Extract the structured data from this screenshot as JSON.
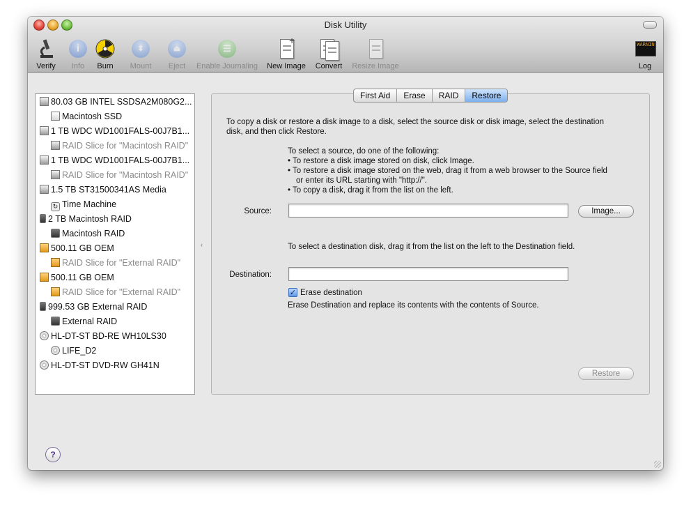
{
  "window": {
    "title": "Disk Utility"
  },
  "toolbar": {
    "items": [
      {
        "label": "Verify",
        "icon": "microscope-icon",
        "enabled": true
      },
      {
        "label": "Info",
        "icon": "info-icon",
        "enabled": false
      },
      {
        "label": "Burn",
        "icon": "burn-icon",
        "enabled": true
      },
      {
        "label": "Mount",
        "icon": "mount-icon",
        "enabled": false
      },
      {
        "label": "Eject",
        "icon": "eject-icon",
        "enabled": false
      },
      {
        "label": "Enable Journaling",
        "icon": "journal-icon",
        "enabled": false
      },
      {
        "label": "New Image",
        "icon": "new-image-icon",
        "enabled": true
      },
      {
        "label": "Convert",
        "icon": "convert-icon",
        "enabled": true
      },
      {
        "label": "Resize Image",
        "icon": "resize-image-icon",
        "enabled": false
      }
    ],
    "log_label": "Log",
    "log_icon_text": "WARNIN"
  },
  "sidebar": {
    "items": [
      {
        "label": "80.03 GB INTEL SSDSA2M080G2...",
        "kind": "disk",
        "dim": false
      },
      {
        "label": "Macintosh SSD",
        "kind": "volume",
        "dim": false
      },
      {
        "label": "1 TB WDC WD1001FALS-00J7B1...",
        "kind": "disk",
        "dim": false
      },
      {
        "label": "RAID Slice for \"Macintosh RAID\"",
        "kind": "volume",
        "dim": true
      },
      {
        "label": "1 TB WDC WD1001FALS-00J7B1...",
        "kind": "disk",
        "dim": false
      },
      {
        "label": "RAID Slice for \"Macintosh RAID\"",
        "kind": "volume",
        "dim": true
      },
      {
        "label": "1.5 TB ST31500341AS Media",
        "kind": "disk",
        "dim": false
      },
      {
        "label": "Time Machine",
        "kind": "timemachine",
        "dim": false
      },
      {
        "label": "2 TB Macintosh RAID",
        "kind": "raid",
        "dim": false
      },
      {
        "label": "Macintosh RAID",
        "kind": "raid-volume",
        "dim": false
      },
      {
        "label": "500.11 GB OEM",
        "kind": "external",
        "dim": false
      },
      {
        "label": "RAID Slice for \"External RAID\"",
        "kind": "external-volume",
        "dim": true
      },
      {
        "label": "500.11 GB OEM",
        "kind": "external",
        "dim": false
      },
      {
        "label": "RAID Slice for \"External RAID\"",
        "kind": "external-volume",
        "dim": true
      },
      {
        "label": "999.53 GB External RAID",
        "kind": "raid",
        "dim": false
      },
      {
        "label": "External RAID",
        "kind": "raid-volume",
        "dim": false
      },
      {
        "label": "HL-DT-ST BD-RE WH10LS30",
        "kind": "optical",
        "dim": false
      },
      {
        "label": "LIFE_D2",
        "kind": "optical-volume",
        "dim": false
      },
      {
        "label": "HL-DT-ST DVD-RW GH41N",
        "kind": "optical",
        "dim": false
      }
    ]
  },
  "tabs": [
    {
      "label": "First Aid",
      "active": false
    },
    {
      "label": "Erase",
      "active": false
    },
    {
      "label": "RAID",
      "active": false
    },
    {
      "label": "Restore",
      "active": true
    }
  ],
  "restore": {
    "intro_line1": "To copy a disk or restore a disk image to a disk, select the source disk or disk image, select the destination",
    "intro_line2": "disk, and then click Restore.",
    "source_heading": "To select a source, do one of the following:",
    "bullet1": "To restore a disk image stored on disk, click Image.",
    "bullet2_line1": "To restore a disk image stored on the web, drag it from a web browser to the Source field",
    "bullet2_line2": "or enter its URL starting with \"http://\".",
    "bullet3": "To copy a disk, drag it from the list on the left.",
    "source_label": "Source:",
    "source_value": "",
    "image_button": "Image...",
    "destination_hint": "To select a destination disk, drag it from the list on the left to the Destination field.",
    "destination_label": "Destination:",
    "destination_value": "",
    "erase_label": "Erase destination",
    "erase_checked": true,
    "erase_note": "Erase Destination and replace its contents with the contents of Source.",
    "restore_button": "Restore"
  },
  "help_label": "?"
}
